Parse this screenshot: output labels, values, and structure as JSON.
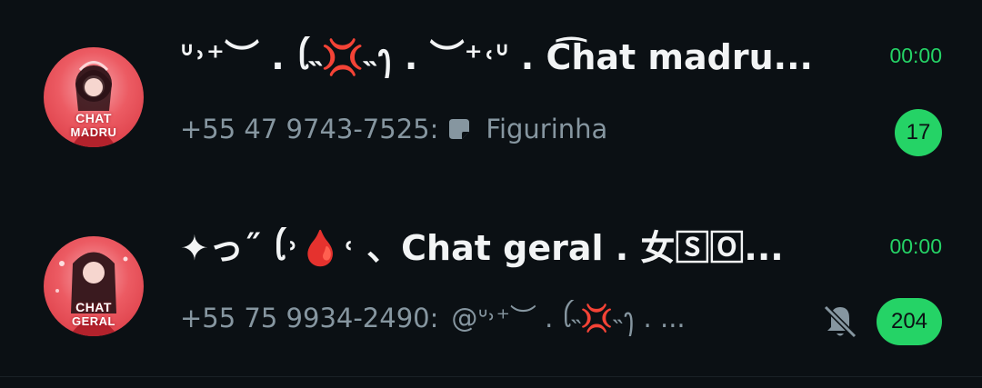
{
  "chats": [
    {
      "title": "ᐡ˒⁺︶ . ꪶ˵💢˵ꫂ . ︶⁺˓ᐡ . C͡hat madru...",
      "avatar_text": [
        "CHAT",
        "MADRU"
      ],
      "time": "00:00",
      "preview_sender": "+55 47 9743-7525:",
      "preview_icon": "sticker-icon",
      "preview_text": "Figurinha",
      "unread": "17",
      "muted": false
    },
    {
      "title": "✦っ˝ ꪶ˒🩸˓ 、Chat geral . 女🅂🄾...",
      "avatar_text": [
        "CHAT",
        "GERAL"
      ],
      "time": "00:00",
      "preview_sender": "+55 75 9934-2490:",
      "preview_text": "@ᐡ˒⁺︶ . ꪶ˵💢˵ꫂ . ...",
      "unread": "204",
      "muted": true
    }
  ],
  "colors": {
    "background": "#0b1014",
    "accent_green": "#25d366",
    "secondary_text": "#8696a0",
    "avatar_red": "#e8434c"
  }
}
